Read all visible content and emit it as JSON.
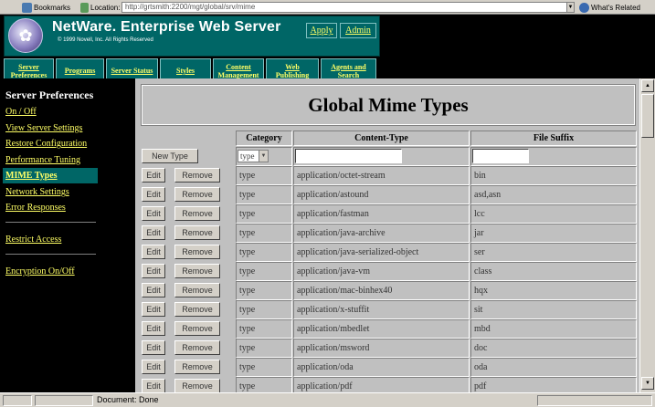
{
  "browser": {
    "bookmarks_label": "Bookmarks",
    "location_label": "Location:",
    "location_value": "http://grtsmith:2200/mgt/global/srv/mime",
    "whats_related_label": "What's Related",
    "status_text": "Document: Done"
  },
  "header": {
    "brand": "NetWare. Enterprise Web Server",
    "copyright": "© 1999 Novell, Inc. All Rights Reserved",
    "apply_label": "Apply",
    "admin_label": "Admin",
    "nav": [
      {
        "label": "Server Preferences"
      },
      {
        "label": "Programs"
      },
      {
        "label": "Server Status"
      },
      {
        "label": "Styles"
      },
      {
        "label": "Content Management"
      },
      {
        "label": "Web Publishing"
      },
      {
        "label": "Agents and Search"
      }
    ]
  },
  "sidebar": {
    "title": "Server Preferences",
    "items": [
      {
        "label": "On / Off"
      },
      {
        "label": "View Server Settings"
      },
      {
        "label": "Restore Configuration"
      },
      {
        "label": "Performance Tuning"
      },
      {
        "label": "MIME Types",
        "active": true
      },
      {
        "label": "Network Settings"
      },
      {
        "label": "Error Responses"
      },
      {
        "label": "Restrict Access"
      },
      {
        "label": "Encryption On/Off"
      }
    ]
  },
  "main": {
    "title": "Global Mime Types",
    "columns": [
      "Category",
      "Content-Type",
      "File Suffix"
    ],
    "new_type_label": "New Type",
    "category_select_value": "type",
    "edit_label": "Edit",
    "remove_label": "Remove",
    "rows": [
      {
        "category": "type",
        "content_type": "application/octet-stream",
        "suffix": "bin"
      },
      {
        "category": "type",
        "content_type": "application/astound",
        "suffix": "asd,asn"
      },
      {
        "category": "type",
        "content_type": "application/fastman",
        "suffix": "lcc"
      },
      {
        "category": "type",
        "content_type": "application/java-archive",
        "suffix": "jar"
      },
      {
        "category": "type",
        "content_type": "application/java-serialized-object",
        "suffix": "ser"
      },
      {
        "category": "type",
        "content_type": "application/java-vm",
        "suffix": "class"
      },
      {
        "category": "type",
        "content_type": "application/mac-binhex40",
        "suffix": "hqx"
      },
      {
        "category": "type",
        "content_type": "application/x-stuffit",
        "suffix": "sit"
      },
      {
        "category": "type",
        "content_type": "application/mbedlet",
        "suffix": "mbd"
      },
      {
        "category": "type",
        "content_type": "application/msword",
        "suffix": "doc"
      },
      {
        "category": "type",
        "content_type": "application/oda",
        "suffix": "oda"
      },
      {
        "category": "type",
        "content_type": "application/pdf",
        "suffix": "pdf"
      }
    ]
  }
}
